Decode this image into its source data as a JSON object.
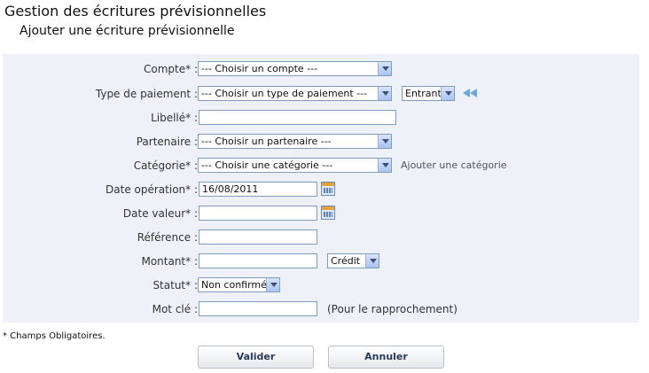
{
  "header": {
    "title": "Gestion des écritures prévisionnelles",
    "subtitle": "Ajouter une écriture prévisionnelle"
  },
  "form": {
    "compte": {
      "label": "Compte* :",
      "value": "--- Choisir un compte ---"
    },
    "type_paiement": {
      "label": "Type de paiement :",
      "value": "--- Choisir un type de paiement ---",
      "direction": "Entrant"
    },
    "libelle": {
      "label": "Libellé* :",
      "value": ""
    },
    "partenaire": {
      "label": "Partenaire :",
      "value": "--- Choisir un partenaire ---"
    },
    "categorie": {
      "label": "Catégorie* :",
      "value": "--- Choisir une catégorie ---",
      "add_link": "Ajouter une catégorie"
    },
    "date_operation": {
      "label": "Date opération* :",
      "value": "16/08/2011"
    },
    "date_valeur": {
      "label": "Date valeur* :",
      "value": ""
    },
    "reference": {
      "label": "Référence :",
      "value": ""
    },
    "montant": {
      "label": "Montant* :",
      "value": "",
      "sens": "Crédit"
    },
    "statut": {
      "label": "Statut* :",
      "value": "Non confirmé"
    },
    "mot_cle": {
      "label": "Mot clé :",
      "value": "",
      "note": "(Pour le rapprochement)"
    }
  },
  "footer": {
    "required_note": "* Champs Obligatoires.",
    "validate_label": "Valider",
    "cancel_label": "Annuler"
  },
  "icons": {
    "calendar": "calendar-icon",
    "back": "double-left-arrow-icon",
    "dropdown": "chevron-down-icon"
  }
}
